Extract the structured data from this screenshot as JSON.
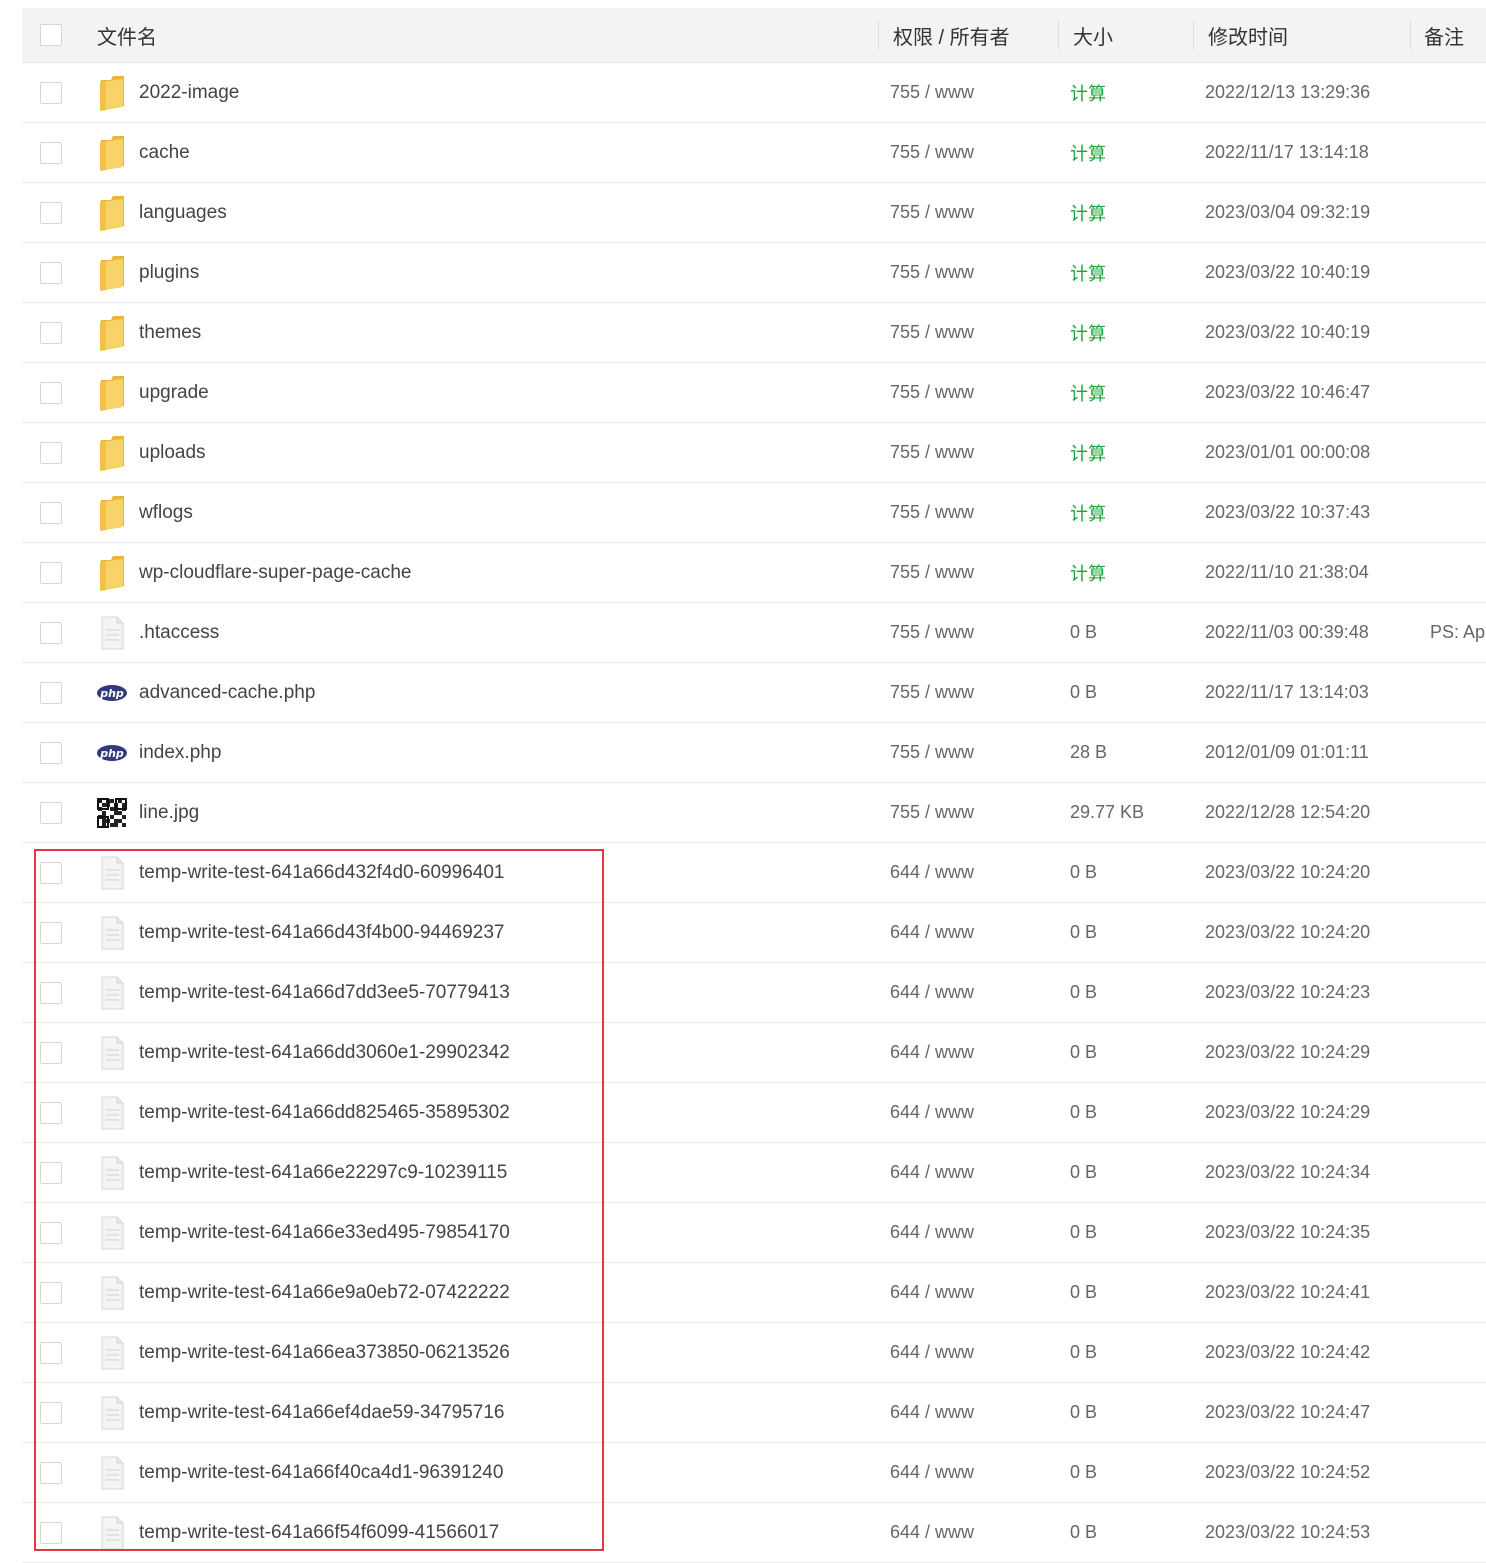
{
  "header": {
    "name": "文件名",
    "perm": "权限 / 所有者",
    "size": "大小",
    "time": "修改时间",
    "note": "备注"
  },
  "rows": [
    {
      "icon": "folder-icon",
      "name": "2022-image",
      "perm": "755 / www",
      "size": "计算",
      "time": "2022/12/13 13:29:36",
      "note": ""
    },
    {
      "icon": "folder-icon",
      "name": "cache",
      "perm": "755 / www",
      "size": "计算",
      "time": "2022/11/17 13:14:18",
      "note": ""
    },
    {
      "icon": "folder-icon",
      "name": "languages",
      "perm": "755 / www",
      "size": "计算",
      "time": "2023/03/04 09:32:19",
      "note": ""
    },
    {
      "icon": "folder-icon",
      "name": "plugins",
      "perm": "755 / www",
      "size": "计算",
      "time": "2023/03/22 10:40:19",
      "note": ""
    },
    {
      "icon": "folder-icon",
      "name": "themes",
      "perm": "755 / www",
      "size": "计算",
      "time": "2023/03/22 10:40:19",
      "note": ""
    },
    {
      "icon": "folder-icon",
      "name": "upgrade",
      "perm": "755 / www",
      "size": "计算",
      "time": "2023/03/22 10:46:47",
      "note": ""
    },
    {
      "icon": "folder-icon",
      "name": "uploads",
      "perm": "755 / www",
      "size": "计算",
      "time": "2023/01/01 00:00:08",
      "note": ""
    },
    {
      "icon": "folder-icon",
      "name": "wflogs",
      "perm": "755 / www",
      "size": "计算",
      "time": "2023/03/22 10:37:43",
      "note": ""
    },
    {
      "icon": "folder-icon",
      "name": "wp-cloudflare-super-page-cache",
      "perm": "755 / www",
      "size": "计算",
      "time": "2022/11/10 21:38:04",
      "note": ""
    },
    {
      "icon": "text-file-icon",
      "name": ".htaccess",
      "perm": "755 / www",
      "size": "0 B",
      "time": "2022/11/03 00:39:48",
      "note": "PS: Ap"
    },
    {
      "icon": "php-file-icon",
      "name": "advanced-cache.php",
      "perm": "755 / www",
      "size": "0 B",
      "time": "2022/11/17 13:14:03",
      "note": ""
    },
    {
      "icon": "php-file-icon",
      "name": "index.php",
      "perm": "755 / www",
      "size": "28 B",
      "time": "2012/01/09 01:01:11",
      "note": ""
    },
    {
      "icon": "qr-image-icon",
      "name": "line.jpg",
      "perm": "755 / www",
      "size": "29.77 KB",
      "time": "2022/12/28 12:54:20",
      "note": ""
    },
    {
      "icon": "text-file-icon",
      "name": "temp-write-test-641a66d432f4d0-60996401",
      "perm": "644 / www",
      "size": "0 B",
      "time": "2023/03/22 10:24:20",
      "note": ""
    },
    {
      "icon": "text-file-icon",
      "name": "temp-write-test-641a66d43f4b00-94469237",
      "perm": "644 / www",
      "size": "0 B",
      "time": "2023/03/22 10:24:20",
      "note": ""
    },
    {
      "icon": "text-file-icon",
      "name": "temp-write-test-641a66d7dd3ee5-70779413",
      "perm": "644 / www",
      "size": "0 B",
      "time": "2023/03/22 10:24:23",
      "note": ""
    },
    {
      "icon": "text-file-icon",
      "name": "temp-write-test-641a66dd3060e1-29902342",
      "perm": "644 / www",
      "size": "0 B",
      "time": "2023/03/22 10:24:29",
      "note": ""
    },
    {
      "icon": "text-file-icon",
      "name": "temp-write-test-641a66dd825465-35895302",
      "perm": "644 / www",
      "size": "0 B",
      "time": "2023/03/22 10:24:29",
      "note": ""
    },
    {
      "icon": "text-file-icon",
      "name": "temp-write-test-641a66e22297c9-10239115",
      "perm": "644 / www",
      "size": "0 B",
      "time": "2023/03/22 10:24:34",
      "note": ""
    },
    {
      "icon": "text-file-icon",
      "name": "temp-write-test-641a66e33ed495-79854170",
      "perm": "644 / www",
      "size": "0 B",
      "time": "2023/03/22 10:24:35",
      "note": ""
    },
    {
      "icon": "text-file-icon",
      "name": "temp-write-test-641a66e9a0eb72-07422222",
      "perm": "644 / www",
      "size": "0 B",
      "time": "2023/03/22 10:24:41",
      "note": ""
    },
    {
      "icon": "text-file-icon",
      "name": "temp-write-test-641a66ea373850-06213526",
      "perm": "644 / www",
      "size": "0 B",
      "time": "2023/03/22 10:24:42",
      "note": ""
    },
    {
      "icon": "text-file-icon",
      "name": "temp-write-test-641a66ef4dae59-34795716",
      "perm": "644 / www",
      "size": "0 B",
      "time": "2023/03/22 10:24:47",
      "note": ""
    },
    {
      "icon": "text-file-icon",
      "name": "temp-write-test-641a66f40ca4d1-96391240",
      "perm": "644 / www",
      "size": "0 B",
      "time": "2023/03/22 10:24:52",
      "note": ""
    },
    {
      "icon": "text-file-icon",
      "name": "temp-write-test-641a66f54f6099-41566017",
      "perm": "644 / www",
      "size": "0 B",
      "time": "2023/03/22 10:24:53",
      "note": ""
    }
  ],
  "colors": {
    "calc_link": "#20a53a",
    "highlight_border": "#e2383f",
    "folder": "#f5c950",
    "php_badge": "#2e3a7c"
  }
}
